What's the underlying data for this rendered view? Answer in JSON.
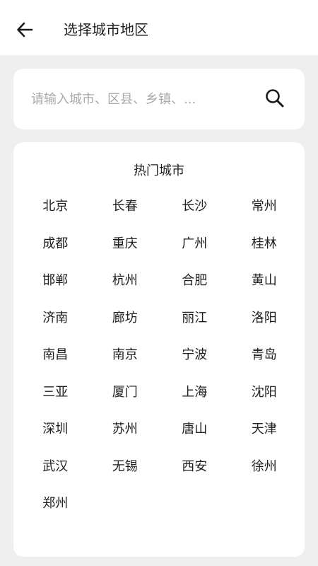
{
  "header": {
    "back_icon": "arrow-left-icon",
    "title": "选择城市地区"
  },
  "search": {
    "placeholder": "请输入城市、区县、乡镇、...",
    "icon": "search-icon"
  },
  "hot_cities": {
    "title": "热门城市",
    "cities": [
      "北京",
      "长春",
      "长沙",
      "常州",
      "成都",
      "重庆",
      "广州",
      "桂林",
      "邯郸",
      "杭州",
      "合肥",
      "黄山",
      "济南",
      "廊坊",
      "丽江",
      "洛阳",
      "南昌",
      "南京",
      "宁波",
      "青岛",
      "三亚",
      "厦门",
      "上海",
      "沈阳",
      "深圳",
      "苏州",
      "唐山",
      "天津",
      "武汉",
      "无锡",
      "西安",
      "徐州",
      "郑州"
    ]
  }
}
